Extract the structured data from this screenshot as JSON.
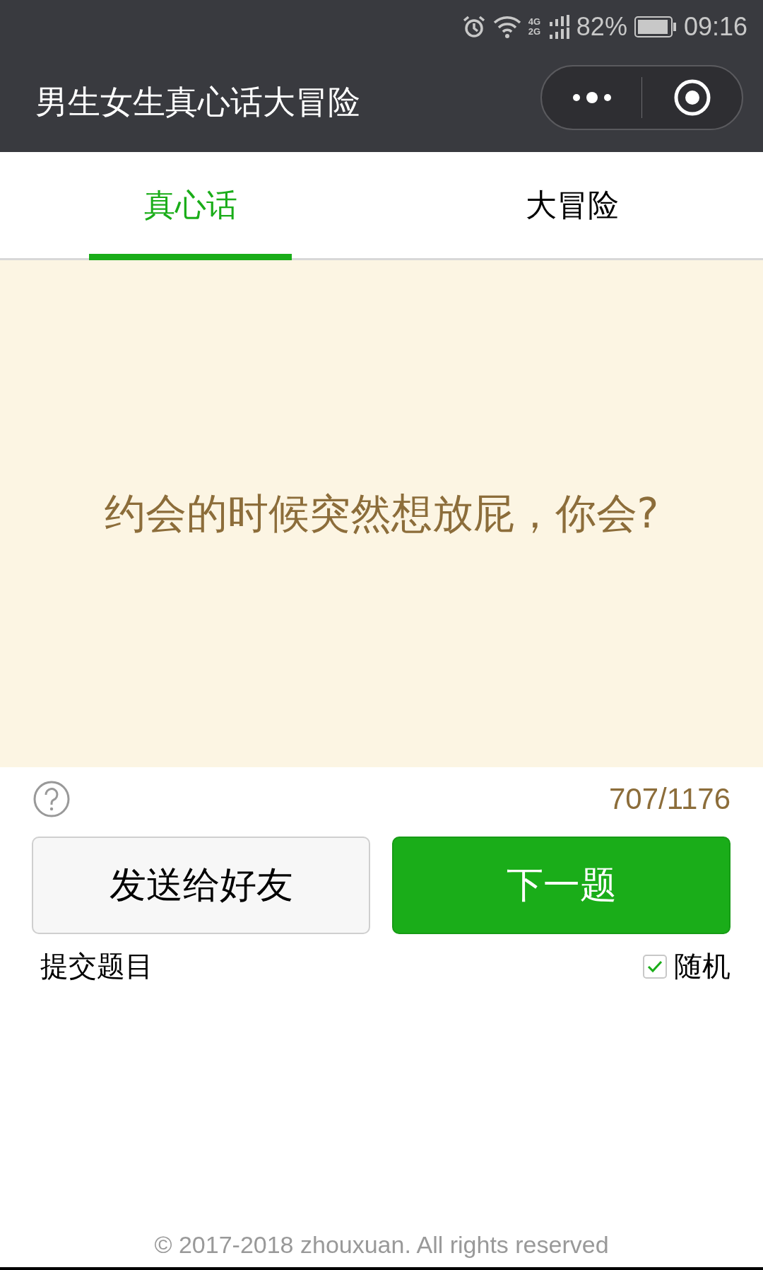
{
  "status_bar": {
    "network": "4G 2G",
    "battery": "82%",
    "time": "09:16"
  },
  "header": {
    "title": "男生女生真心话大冒险"
  },
  "tabs": [
    {
      "label": "真心话",
      "selected": true
    },
    {
      "label": "大冒险",
      "selected": false
    }
  ],
  "question": "约会的时候突然想放屁，你会?",
  "counter": "707/1176",
  "buttons": [
    {
      "label": "发送给好友",
      "kind": "secondary"
    },
    {
      "label": "下一题",
      "kind": "primary"
    }
  ],
  "submit_link": "提交题目",
  "random": {
    "label": "随机",
    "checked": true
  },
  "footer": "© 2017-2018 zhouxuan. All rights reserved"
}
